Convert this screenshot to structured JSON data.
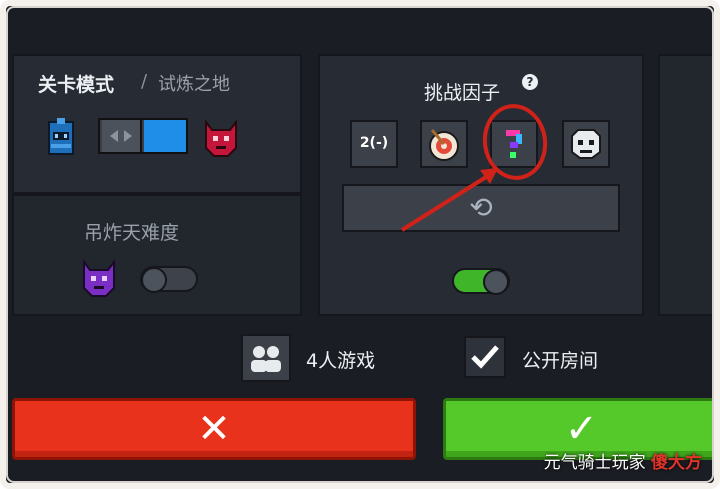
{
  "mode_panel": {
    "title": "关卡模式",
    "separator": "/",
    "subtitle": "试炼之地",
    "slider_level": 0.5
  },
  "bomb_panel": {
    "title": "吊炸天难度",
    "toggle_on": false
  },
  "challenge_panel": {
    "title": "挑战因子",
    "help": "?",
    "factors": [
      {
        "label": "2(-)"
      },
      {
        "label": "◎"
      },
      {
        "label": "?"
      },
      {
        "label": "☠"
      }
    ],
    "refresh_icon": "refresh-icon",
    "toggle_on": true
  },
  "bottom": {
    "four_player_label": "4人游戏",
    "public_room_label": "公开房间",
    "public_room_checked": true,
    "cancel_glyph": "✕",
    "confirm_glyph": "✓"
  },
  "watermark": {
    "text": "元气骑士玩家",
    "brand": "傻大方"
  },
  "colors": {
    "accent_blue": "#1e8ee8",
    "cancel_red": "#e8321c",
    "confirm_green": "#56c92a",
    "annotation_red": "#d1221a"
  }
}
